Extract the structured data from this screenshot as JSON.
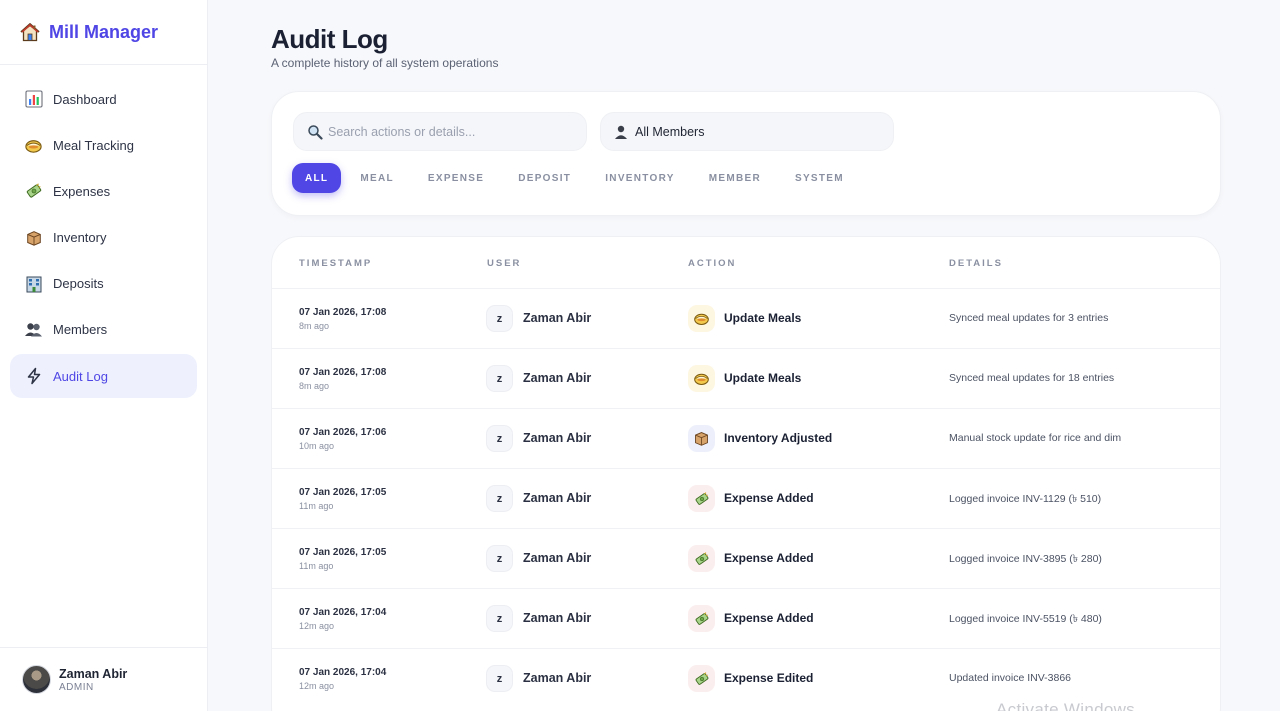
{
  "brand": {
    "title": "Mill Manager",
    "icon": "house-icon"
  },
  "sidebar": {
    "items": [
      {
        "label": "Dashboard",
        "icon": "bar-chart-icon",
        "active": false
      },
      {
        "label": "Meal Tracking",
        "icon": "meal-bowl-icon",
        "active": false
      },
      {
        "label": "Expenses",
        "icon": "money-icon",
        "active": false
      },
      {
        "label": "Inventory",
        "icon": "box-icon",
        "active": false
      },
      {
        "label": "Deposits",
        "icon": "bank-icon",
        "active": false
      },
      {
        "label": "Members",
        "icon": "users-icon",
        "active": false
      },
      {
        "label": "Audit Log",
        "icon": "lightning-icon",
        "active": true
      }
    ]
  },
  "user": {
    "name": "Zaman Abir",
    "role": "ADMIN"
  },
  "page": {
    "title": "Audit Log",
    "subtitle": "A complete history of all system operations"
  },
  "filters": {
    "search_placeholder": "Search actions or details...",
    "member_select": "All Members",
    "chips": [
      "ALL",
      "MEAL",
      "EXPENSE",
      "DEPOSIT",
      "INVENTORY",
      "MEMBER",
      "SYSTEM"
    ],
    "active_chip": "ALL"
  },
  "table": {
    "headers": {
      "timestamp": "TIMESTAMP",
      "user": "USER",
      "action": "ACTION",
      "details": "DETAILS"
    },
    "rows": [
      {
        "timestamp": "07 Jan 2026, 17:08",
        "ago": "8m ago",
        "user_initial": "z",
        "user": "Zaman Abir",
        "action": "Update Meals",
        "action_type": "meal",
        "details": "Synced meal updates for 3 entries"
      },
      {
        "timestamp": "07 Jan 2026, 17:08",
        "ago": "8m ago",
        "user_initial": "z",
        "user": "Zaman Abir",
        "action": "Update Meals",
        "action_type": "meal",
        "details": "Synced meal updates for 18 entries"
      },
      {
        "timestamp": "07 Jan 2026, 17:06",
        "ago": "10m ago",
        "user_initial": "z",
        "user": "Zaman Abir",
        "action": "Inventory Adjusted",
        "action_type": "inventory",
        "details": "Manual stock update for rice and dim"
      },
      {
        "timestamp": "07 Jan 2026, 17:05",
        "ago": "11m ago",
        "user_initial": "z",
        "user": "Zaman Abir",
        "action": "Expense Added",
        "action_type": "expense",
        "details": "Logged invoice INV-1129 (৳ 510)"
      },
      {
        "timestamp": "07 Jan 2026, 17:05",
        "ago": "11m ago",
        "user_initial": "z",
        "user": "Zaman Abir",
        "action": "Expense Added",
        "action_type": "expense",
        "details": "Logged invoice INV-3895 (৳ 280)"
      },
      {
        "timestamp": "07 Jan 2026, 17:04",
        "ago": "12m ago",
        "user_initial": "z",
        "user": "Zaman Abir",
        "action": "Expense Added",
        "action_type": "expense",
        "details": "Logged invoice INV-5519 (৳ 480)"
      },
      {
        "timestamp": "07 Jan 2026, 17:04",
        "ago": "12m ago",
        "user_initial": "z",
        "user": "Zaman Abir",
        "action": "Expense Edited",
        "action_type": "expense",
        "details": "Updated invoice INV-3866"
      }
    ]
  },
  "watermark": "Activate Windows",
  "colors": {
    "accent": "#4f46e5",
    "active_nav_bg": "#eef1fd",
    "page_bg": "#f7f8fb"
  }
}
